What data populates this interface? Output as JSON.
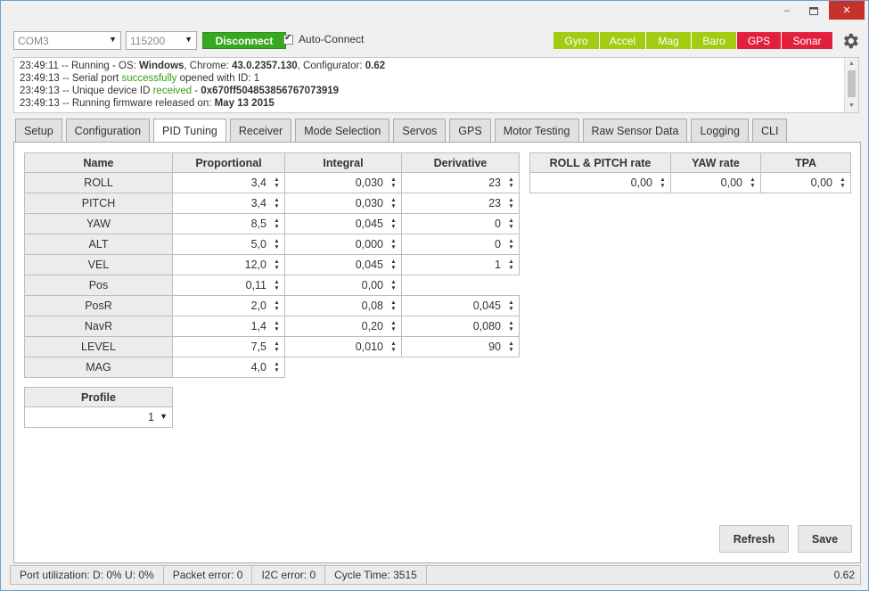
{
  "window": {
    "min": "–",
    "close": "✕"
  },
  "connection": {
    "port": "COM3",
    "baud": "115200",
    "disconnect_label": "Disconnect",
    "auto_connect_label": "Auto-Connect",
    "auto_connect_checked": true
  },
  "sensors": [
    {
      "label": "Gyro",
      "state": "on"
    },
    {
      "label": "Accel",
      "state": "on"
    },
    {
      "label": "Mag",
      "state": "on"
    },
    {
      "label": "Baro",
      "state": "on"
    },
    {
      "label": "GPS",
      "state": "off"
    },
    {
      "label": "Sonar",
      "state": "off"
    }
  ],
  "log": {
    "l1": {
      "time": "23:49:11",
      "pre": " -- Running - OS: ",
      "os": "Windows",
      "mid": ", Chrome: ",
      "chrome": "43.0.2357.130",
      "mid2": ", Configurator: ",
      "conf": "0.62"
    },
    "l2": {
      "time": "23:49:13",
      "pre": " -- Serial port ",
      "ok": "successfully",
      "post": " opened with ID: 1"
    },
    "l3": {
      "time": "23:49:13",
      "pre": " -- Unique device ID ",
      "ok": "received",
      "post": " - ",
      "id": "0x670ff504853856767073919"
    },
    "l4": {
      "time": "23:49:13",
      "pre": " -- Running firmware released on: ",
      "date": "May 13 2015"
    }
  },
  "tabs": [
    "Setup",
    "Configuration",
    "PID Tuning",
    "Receiver",
    "Mode Selection",
    "Servos",
    "GPS",
    "Motor Testing",
    "Raw Sensor Data",
    "Logging",
    "CLI"
  ],
  "active_tab": "PID Tuning",
  "pid": {
    "headers": [
      "Name",
      "Proportional",
      "Integral",
      "Derivative"
    ],
    "rows": [
      {
        "name": "ROLL",
        "p": "3,4",
        "i": "0,030",
        "d": "23"
      },
      {
        "name": "PITCH",
        "p": "3,4",
        "i": "0,030",
        "d": "23"
      },
      {
        "name": "YAW",
        "p": "8,5",
        "i": "0,045",
        "d": "0"
      },
      {
        "name": "ALT",
        "p": "5,0",
        "i": "0,000",
        "d": "0"
      },
      {
        "name": "VEL",
        "p": "12,0",
        "i": "0,045",
        "d": "1"
      },
      {
        "name": "Pos",
        "p": "0,11",
        "i": "0,00",
        "d": null
      },
      {
        "name": "PosR",
        "p": "2,0",
        "i": "0,08",
        "d": "0,045"
      },
      {
        "name": "NavR",
        "p": "1,4",
        "i": "0,20",
        "d": "0,080"
      },
      {
        "name": "LEVEL",
        "p": "7,5",
        "i": "0,010",
        "d": "90"
      },
      {
        "name": "MAG",
        "p": "4,0",
        "i": null,
        "d": null
      }
    ]
  },
  "rates": {
    "headers": [
      "ROLL & PITCH rate",
      "YAW rate",
      "TPA"
    ],
    "values": [
      "0,00",
      "0,00",
      "0,00"
    ]
  },
  "profile": {
    "header": "Profile",
    "value": "1"
  },
  "buttons": {
    "refresh": "Refresh",
    "save": "Save"
  },
  "status": {
    "port_util": "Port utilization: D: 0% U: 0%",
    "packet_error": "Packet error: 0",
    "i2c_error": "I2C error: 0",
    "cycle_time": "Cycle Time: 3515",
    "version": "0.62"
  }
}
